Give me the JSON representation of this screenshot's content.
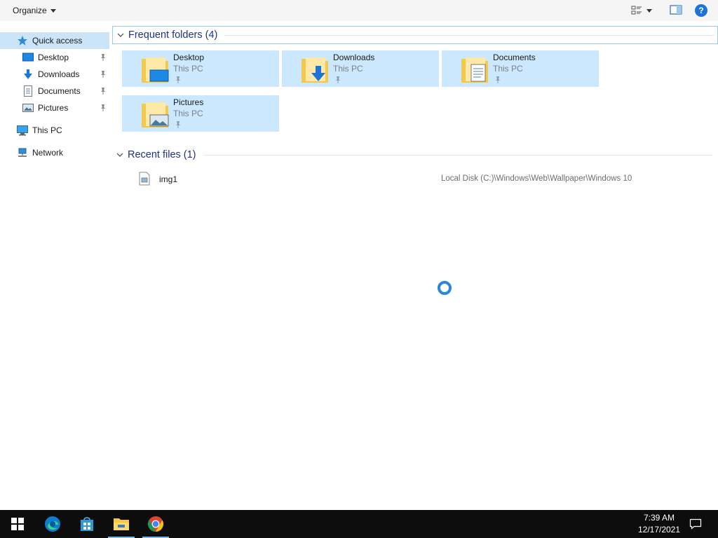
{
  "command_bar": {
    "organize_label": "Organize"
  },
  "nav": {
    "quick_access": "Quick access",
    "items": [
      {
        "label": "Desktop",
        "icon": "desktop-icon"
      },
      {
        "label": "Downloads",
        "icon": "downloads-icon"
      },
      {
        "label": "Documents",
        "icon": "documents-icon"
      },
      {
        "label": "Pictures",
        "icon": "pictures-icon"
      }
    ],
    "this_pc": "This PC",
    "network": "Network"
  },
  "frequent": {
    "header": "Frequent folders (4)",
    "tiles": [
      {
        "name": "Desktop",
        "location": "This PC"
      },
      {
        "name": "Downloads",
        "location": "This PC"
      },
      {
        "name": "Documents",
        "location": "This PC"
      },
      {
        "name": "Pictures",
        "location": "This PC"
      }
    ]
  },
  "recent": {
    "header": "Recent files (1)",
    "files": [
      {
        "name": "img1",
        "path": "Local Disk (C:)\\Windows\\Web\\Wallpaper\\Windows 10"
      }
    ]
  },
  "taskbar": {
    "apps": [
      "start-icon",
      "edge-icon",
      "store-icon",
      "file-explorer-icon",
      "chrome-icon"
    ],
    "time": "7:39 AM",
    "date": "12/17/2021"
  },
  "colors": {
    "selection": "#cce8ff",
    "header_text": "#1e3287",
    "accent": "#2b86d7",
    "taskbar": "#0d0d0d"
  }
}
